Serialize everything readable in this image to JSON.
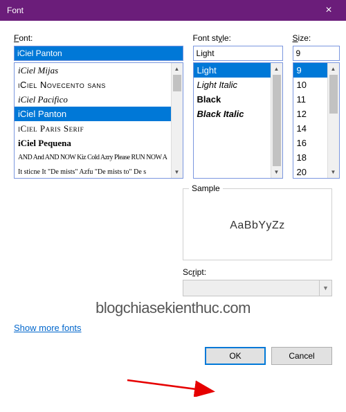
{
  "title": "Font",
  "labels": {
    "font": "Font:",
    "style": "Font style:",
    "size": "Size:",
    "sample": "Sample",
    "script": "Script:"
  },
  "font": {
    "value": "iCiel Panton",
    "items": [
      "iCiel Mijas",
      "iCiel Novecento sans",
      "iCiel Pacifico",
      "iCiel Panton",
      "iCiel Paris Serif",
      "iCiel Pequena",
      "AND And AND NOW Kiz  Cold Azry Please RUN NOW A",
      "It sticne It \"De mists\" Azfu \"De mists to\" De s"
    ],
    "selected_index": 3
  },
  "style": {
    "value": "Light",
    "items": [
      "Light",
      "Light Italic",
      "Black",
      "Black Italic"
    ],
    "selected_index": 0
  },
  "size": {
    "value": "9",
    "items": [
      "9",
      "10",
      "11",
      "12",
      "14",
      "16",
      "18",
      "20"
    ],
    "selected_index": 0
  },
  "sample_text": "AaBbYyZz",
  "script_value": "",
  "link": "Show more fonts",
  "buttons": {
    "ok": "OK",
    "cancel": "Cancel"
  },
  "watermark": "blogchiasekienthuc.com"
}
